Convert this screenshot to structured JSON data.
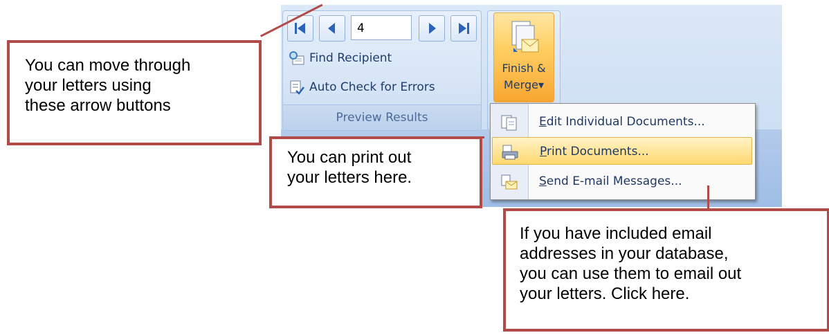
{
  "preview_group": {
    "record_number": "4",
    "find_recipient_label": "Find Recipient",
    "auto_check_label": "Auto Check for Errors",
    "group_label": "Preview Results"
  },
  "finish_group": {
    "button_label_line1": "Finish &",
    "button_label_line2": "Merge",
    "dropdown_arrow": "▾"
  },
  "menu": {
    "items": [
      {
        "label_first": "E",
        "label_rest": "dit Individual Documents...",
        "icon": "edit-documents-icon"
      },
      {
        "label_first": "P",
        "label_rest": "rint Documents...",
        "icon": "printer-icon"
      },
      {
        "label_first": "S",
        "label_rest": "end E-mail Messages...",
        "icon": "email-icon"
      }
    ]
  },
  "callouts": {
    "navigate": [
      "You can move through",
      "your letters using",
      "these arrow buttons"
    ],
    "print": [
      "You can print out",
      "your letters here."
    ],
    "email": [
      "If you have included email",
      "addresses in your database,",
      "you can use them to email out",
      "your letters. Click here."
    ]
  },
  "colors": {
    "callout_border": "#b24a48",
    "ribbon_blue": "#dbe8f7",
    "finish_orange": "#ffcf63",
    "menu_highlight": "#ffd86f"
  }
}
